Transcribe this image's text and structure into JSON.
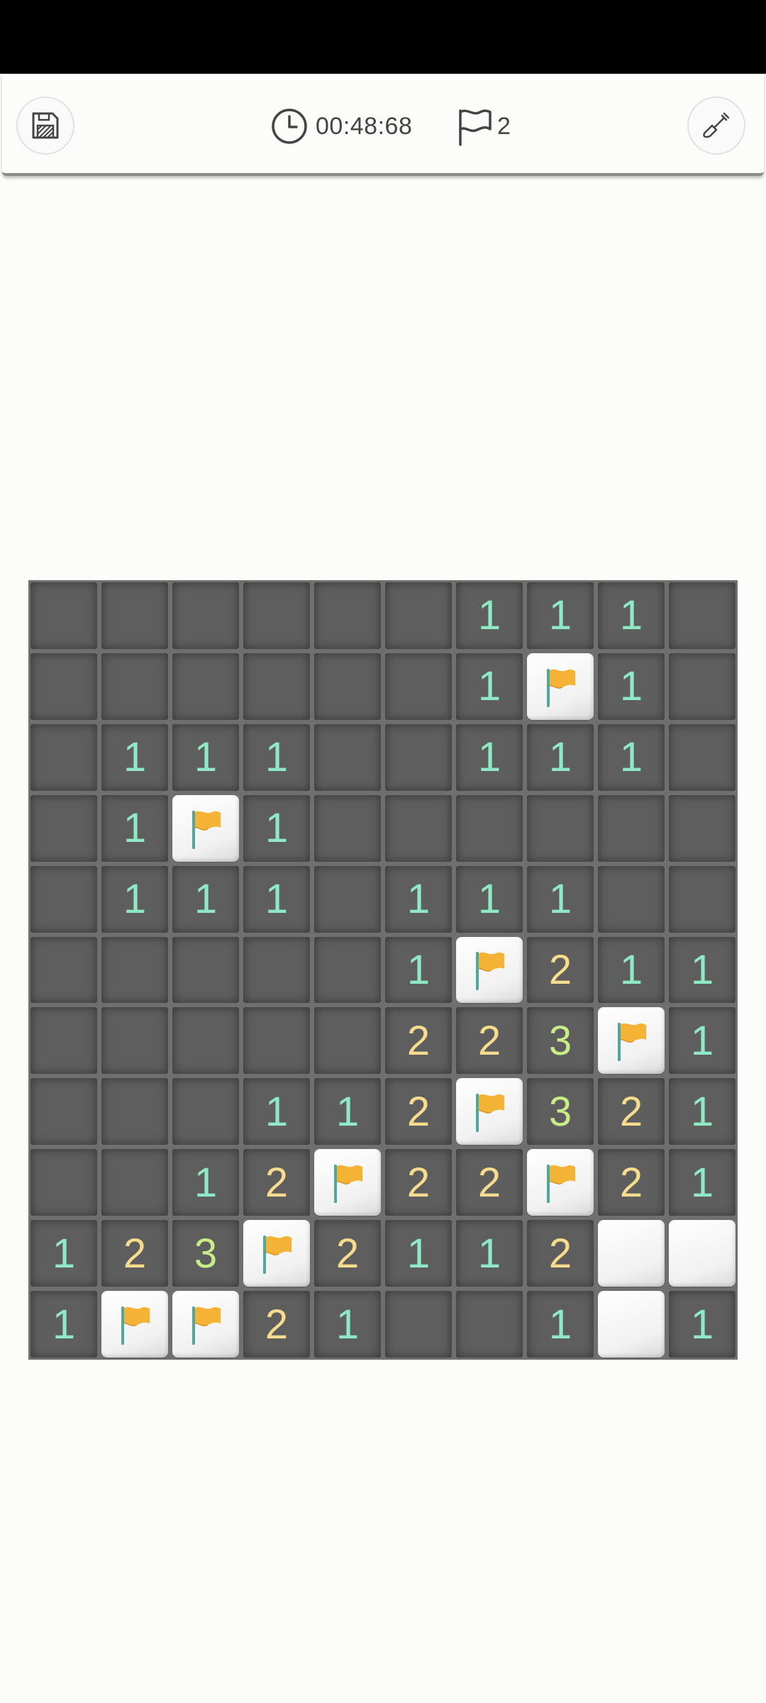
{
  "header": {
    "timer": "00:48:68",
    "flags_count": "2"
  },
  "board": {
    "columns": 10,
    "rows": [
      [
        "covered",
        "covered",
        "covered",
        "covered",
        "covered",
        "covered",
        "1",
        "1",
        "1",
        "covered"
      ],
      [
        "covered",
        "covered",
        "covered",
        "covered",
        "covered",
        "covered",
        "1",
        "flag",
        "1",
        "covered"
      ],
      [
        "covered",
        "1",
        "1",
        "1",
        "covered",
        "covered",
        "1",
        "1",
        "1",
        "covered"
      ],
      [
        "covered",
        "1",
        "flag",
        "1",
        "covered",
        "covered",
        "covered",
        "covered",
        "covered",
        "covered"
      ],
      [
        "covered",
        "1",
        "1",
        "1",
        "covered",
        "1",
        "1",
        "1",
        "covered",
        "covered"
      ],
      [
        "covered",
        "covered",
        "covered",
        "covered",
        "covered",
        "1",
        "flag",
        "2",
        "1",
        "1"
      ],
      [
        "covered",
        "covered",
        "covered",
        "covered",
        "covered",
        "2",
        "2",
        "3",
        "flag",
        "1"
      ],
      [
        "covered",
        "covered",
        "covered",
        "1",
        "1",
        "2",
        "flag",
        "3",
        "2",
        "1"
      ],
      [
        "covered",
        "covered",
        "1",
        "2",
        "flag",
        "2",
        "2",
        "flag",
        "2",
        "1"
      ],
      [
        "1",
        "2",
        "3",
        "flag",
        "2",
        "1",
        "1",
        "2",
        "blank",
        "blank"
      ],
      [
        "1",
        "flag",
        "flag",
        "2",
        "1",
        "covered",
        "covered",
        "1",
        "blank",
        "1"
      ]
    ]
  },
  "colors": {
    "number_1": "#8fe8c8",
    "number_2": "#f6dc8c",
    "number_3": "#c8ec86",
    "flag": "#f5b335"
  }
}
